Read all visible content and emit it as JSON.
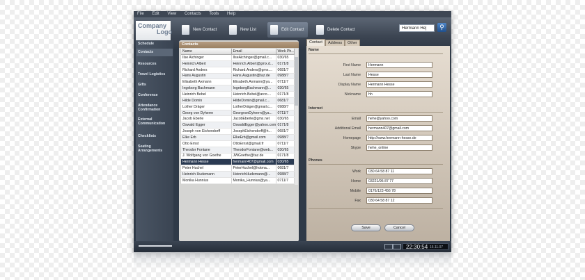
{
  "menu": [
    "File",
    "Edit",
    "View",
    "Contacts",
    "Tools",
    "Help"
  ],
  "logo": {
    "line1": "Company",
    "line2": "Logo"
  },
  "toolbar": {
    "new_contact": "New Contact",
    "new_list": "New List",
    "edit_contact": "Edit Contact",
    "delete_contact": "Delete Contact"
  },
  "search": {
    "value": "Hermann He|"
  },
  "sidebar": {
    "items": [
      "Schedule",
      "Contacts",
      "Resources",
      "Travel Logistics",
      "Gifts",
      "Conference",
      "Attendance Confirmation",
      "External Communication",
      "Checklists",
      "Seating Arrangements"
    ],
    "active": "Contacts"
  },
  "contacts_panel": {
    "title": "Contacts",
    "columns": [
      "Name",
      "Email",
      "Work Ph..."
    ],
    "rows": [
      [
        "Ilse Aichinger",
        "IlseAichinger@gmail.c...",
        "030/65"
      ],
      [
        "Heinrich Albert",
        "Heinrich.Albert@gmx.d...",
        "0171/8"
      ],
      [
        "Richard Anders",
        "Richard.Anders@gmx....",
        "0681/7"
      ],
      [
        "Hans Augustin",
        "Hans.Augustin@taz.de",
        "0988/7"
      ],
      [
        "Elisabeth Axmann",
        "Elisabeth.Axmann@ya...",
        "0711/7"
      ],
      [
        "Ingeborg Bachmann",
        "IngeborgBachmann@...",
        "030/65"
      ],
      [
        "Heinrich Bebel",
        "Heinrich.Bebel@arco....",
        "0171/8"
      ],
      [
        "Hilde Domin",
        "HildeDomin@gmail.c...",
        "0681/7"
      ],
      [
        "Lother Dräger",
        "LotherDräger@gmail.c...",
        "0988/7"
      ],
      [
        "Georg von Dyherrn",
        "GeorgvonDyherrn@ya...",
        "0711/7"
      ],
      [
        "Jacob Eberle",
        "JacobEberle@gmx.net",
        "030/65"
      ],
      [
        "Oswald Egger",
        "OswaldEgger@yahoo.com",
        "0171/8"
      ],
      [
        "Joseph von Eichendorff",
        "JosephEichendorff@h...",
        "0681/7"
      ],
      [
        "Elke Erb",
        "ElkeErb@gmail.com",
        "0988/7"
      ],
      [
        "Otto Ernst",
        "OttoErnst@gmail.fr",
        "0711/7"
      ],
      [
        "Theodor Fontane",
        "TheodorFontane@web...",
        "030/65"
      ],
      [
        "J. Wolfgang von Goethe",
        "JWGoethe@taz.de",
        "0171/8"
      ],
      [
        "Hermann Hesse",
        "hermann407@gmail.com",
        "030/65"
      ],
      [
        "Peter Huchel",
        "PeterHuchel@hotma...",
        "0681/7"
      ],
      [
        "Heinrich Hudemann",
        "HeinrichHudemann@...",
        "0988/7"
      ],
      [
        "Monika Hunnius",
        "Monika_Hunnius@ya...",
        "0711/7"
      ]
    ],
    "selected_index": 17
  },
  "detail": {
    "tabs": [
      "Contact",
      "Address",
      "Other"
    ],
    "active_tab": "Contact",
    "sections": {
      "name": "Name",
      "internet": "Internet",
      "phones": "Phones"
    },
    "fields": {
      "first_name": {
        "label": "First Name",
        "value": "Hermann"
      },
      "last_name": {
        "label": "Last Name",
        "value": "Hesse"
      },
      "display_name": {
        "label": "Display Name",
        "value": "Hermann Hesse"
      },
      "nickname": {
        "label": "Nickname",
        "value": "hh"
      },
      "email": {
        "label": "Email",
        "value": "hehe@yahoo.com"
      },
      "additional_email": {
        "label": "Additional Email",
        "value": "hermann407@gmail.com"
      },
      "homepage": {
        "label": "Homepage",
        "value": "http://www.hermann-hesse.de"
      },
      "skype": {
        "label": "Skype",
        "value": "hehe_online"
      },
      "work": {
        "label": "Work",
        "value": "030 64 58 87 11"
      },
      "home": {
        "label": "Home",
        "value": "03221/95 87 77"
      },
      "mobile": {
        "label": "Mobile",
        "value": "0176/123 456 78"
      },
      "fax": {
        "label": "Fax",
        "value": "030 64 58 87 12"
      }
    },
    "save_label": "Save",
    "cancel_label": "Cancel"
  },
  "status": {
    "time": "22:30:54",
    "date": "16.11.07"
  }
}
